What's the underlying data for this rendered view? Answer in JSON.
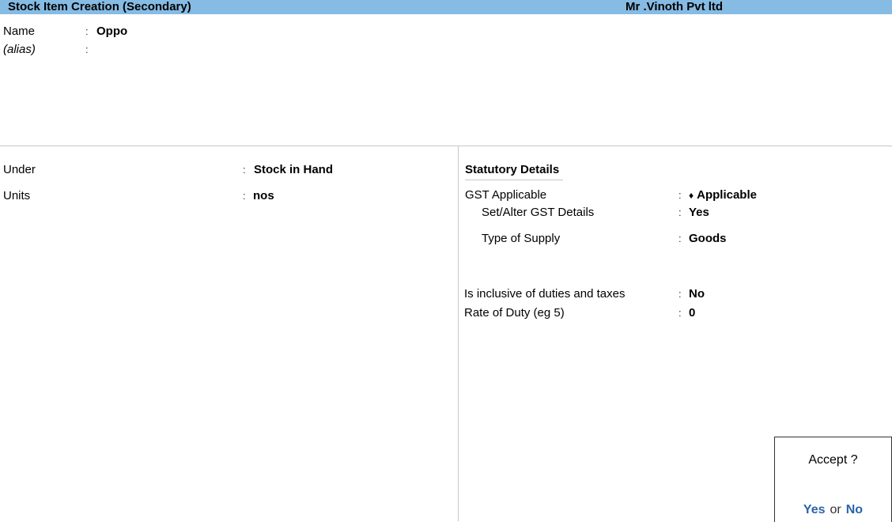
{
  "header": {
    "title": "Stock Item Creation (Secondary)",
    "company": "Mr .Vinoth  Pvt ltd"
  },
  "top_fields": {
    "name_label": "Name",
    "name_value": "Oppo",
    "alias_label": "(alias)",
    "alias_value": ""
  },
  "left_fields": {
    "under_label": "Under",
    "under_value": "Stock in Hand",
    "units_label": "Units",
    "units_value": "nos"
  },
  "statutory": {
    "heading": "Statutory Details",
    "gst_applicable_label": "GST Applicable",
    "gst_applicable_value": "Applicable",
    "gst_applicable_marker": "♦",
    "set_alter_label": "Set/Alter GST Details",
    "set_alter_value": "Yes",
    "type_supply_label": "Type of Supply",
    "type_supply_value": "Goods",
    "inclusive_label": "Is inclusive of duties and taxes",
    "inclusive_value": "No",
    "rate_label": "Rate of Duty (eg 5)",
    "rate_value": "0"
  },
  "separator": ":",
  "accept_dialog": {
    "question": "Accept ?",
    "yes": "Yes",
    "or": "or",
    "no": "No"
  },
  "colors": {
    "title_bar": "#86bbe3",
    "option_blue": "#2a64a8"
  }
}
